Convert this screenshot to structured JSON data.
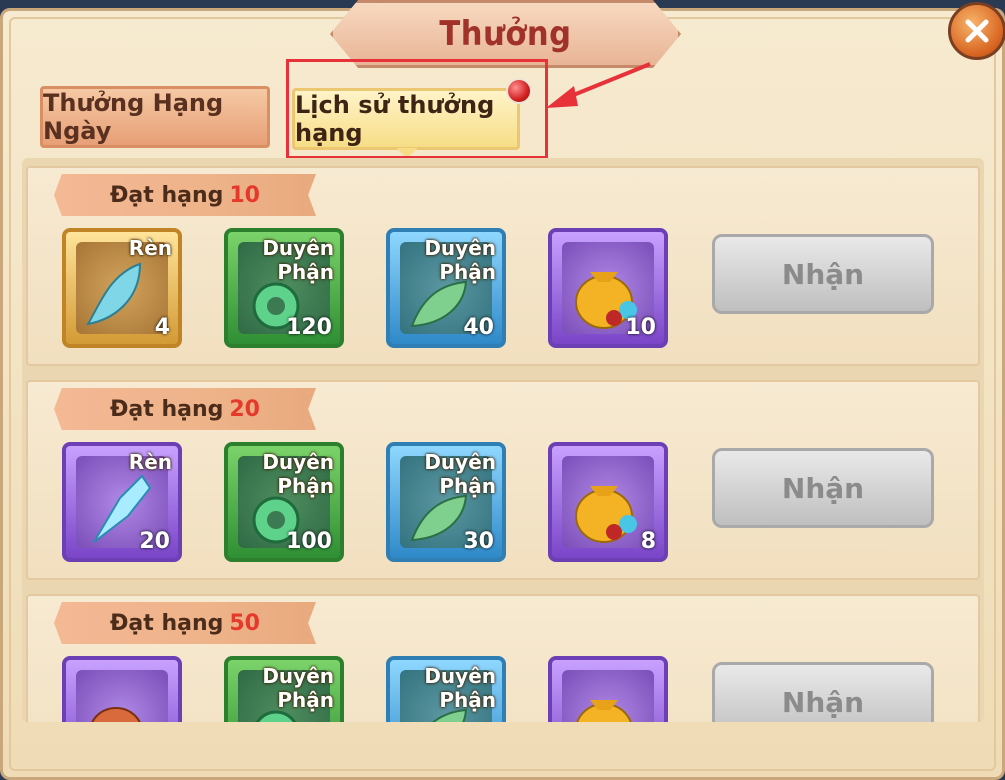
{
  "window": {
    "title": "Thưởng"
  },
  "tabs": [
    {
      "label": "Thưởng Hạng Ngày",
      "active": false
    },
    {
      "label": "Lịch sử thưởng hạng",
      "active": true,
      "has_notification": true
    }
  ],
  "colors": {
    "title": "#a1322a",
    "rank_number": "#e5392c",
    "highlight": "#e8323a"
  },
  "rank_cards": [
    {
      "rank_label": "Đạt hạng",
      "rank_value": "10",
      "claim_label": "Nhận",
      "items": [
        {
          "label": "Rèn",
          "qty": "4",
          "rarity": "gold",
          "icon": "crescent-gem-icon"
        },
        {
          "label": "Duyên Phận",
          "qty": "120",
          "rarity": "green",
          "icon": "jade-ring-icon"
        },
        {
          "label": "Duyên Phận",
          "qty": "40",
          "rarity": "blue",
          "icon": "jade-leaf-icon"
        },
        {
          "label": "",
          "qty": "10",
          "rarity": "purple",
          "icon": "gold-pouch-icon"
        }
      ]
    },
    {
      "rank_label": "Đạt hạng",
      "rank_value": "20",
      "claim_label": "Nhận",
      "items": [
        {
          "label": "Rèn",
          "qty": "20",
          "rarity": "purple",
          "icon": "crystal-shard-icon"
        },
        {
          "label": "Duyên Phận",
          "qty": "100",
          "rarity": "green",
          "icon": "jade-ring-icon"
        },
        {
          "label": "Duyên Phận",
          "qty": "30",
          "rarity": "blue",
          "icon": "jade-leaf-icon"
        },
        {
          "label": "",
          "qty": "8",
          "rarity": "purple",
          "icon": "gold-pouch-icon"
        }
      ]
    },
    {
      "rank_label": "Đạt hạng",
      "rank_value": "50",
      "claim_label": "Nhận",
      "items": [
        {
          "label": "",
          "qty": "",
          "rarity": "purple",
          "icon": "treasure-pouch-icon"
        },
        {
          "label": "Duyên Phận",
          "qty": "",
          "rarity": "green",
          "icon": "jade-ring-icon"
        },
        {
          "label": "Duyên Phận",
          "qty": "",
          "rarity": "blue",
          "icon": "jade-leaf-icon"
        },
        {
          "label": "",
          "qty": "",
          "rarity": "purple",
          "icon": "gold-pouch-icon"
        }
      ]
    }
  ]
}
